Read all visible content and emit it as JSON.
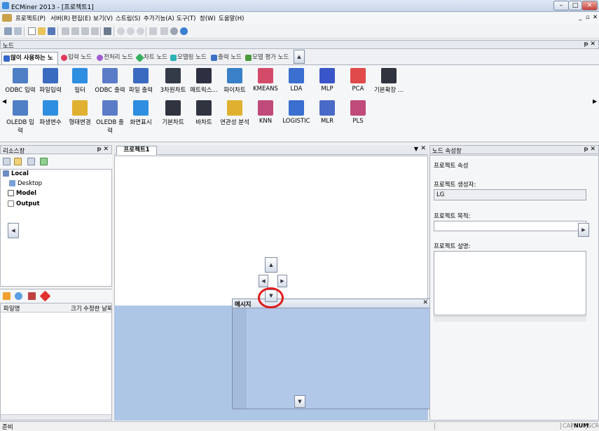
{
  "window": {
    "title": "ECMiner 2013 - [프로젝트1]"
  },
  "menu": [
    "프로젝트(P)",
    "서버(R)",
    "편집(E)",
    "보기(V)",
    "스트림(S)",
    "추가기능(A)",
    "도구(T)",
    "창(W)",
    "도움말(H)"
  ],
  "node_panel": {
    "title": "노드",
    "tabs": [
      "많이 사용하는 노드",
      "입력 노드",
      "전처리 노드",
      "차트 노드",
      "모델링 노드",
      "출력 노드",
      "모델 평가 노드"
    ],
    "row1": [
      "ODBC 입력",
      "파일입력",
      "필터",
      "ODBC 출력",
      "파일 출력",
      "3차원차트",
      "매트릭스...",
      "파이차트",
      "KMEANS",
      "LDA",
      "MLP",
      "PCA",
      "기본확장 ..."
    ],
    "row2": [
      "OLEDB 입력",
      "파생변수",
      "형태변경",
      "OLEDB 출력",
      "화면표시",
      "기본차트",
      "바차트",
      "연관성 분석",
      "KNN",
      "LOGISTIC",
      "MLR",
      "PLS"
    ]
  },
  "resource_panel": {
    "title": "리소스창",
    "tree": [
      "Local",
      "Desktop",
      "Model",
      "Output"
    ]
  },
  "file_list": {
    "headers": [
      "파일명",
      "크기",
      "수정한 날짜"
    ]
  },
  "project": {
    "tab": "프로젝트1"
  },
  "message_window": {
    "title": "메시지"
  },
  "properties": {
    "title": "노드 속성창",
    "section": "프로젝트 속성",
    "creator_label": "프로젝트 생성자:",
    "creator_value": "LG",
    "purpose_label": "프로젝트 목적:",
    "desc_label": "프로젝트 설명:"
  },
  "status": {
    "text": "준비",
    "cap": "CAP",
    "num": "NUM",
    "scrl": "SCRL"
  },
  "colors": {
    "dock_highlight": "#aec6e6",
    "circle": "#e11b1b"
  }
}
